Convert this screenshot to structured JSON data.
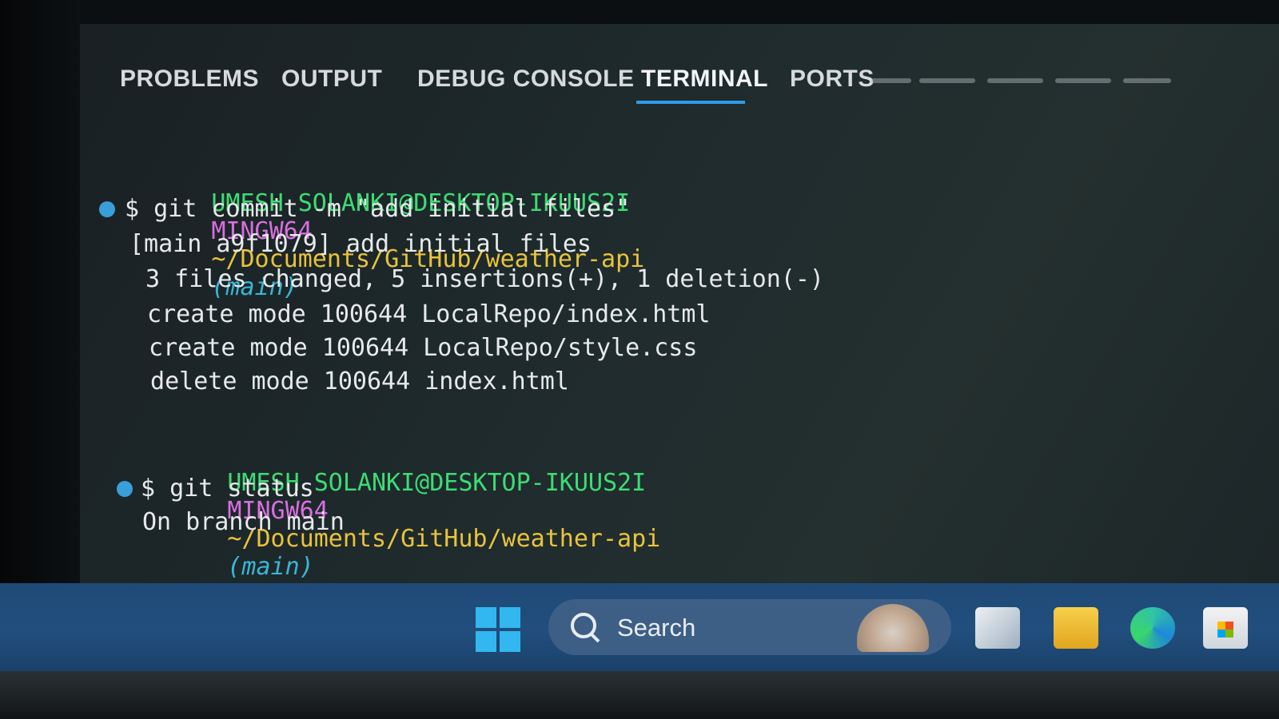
{
  "tabs": [
    {
      "label": "PROBLEMS"
    },
    {
      "label": "OUTPUT"
    },
    {
      "label": "DEBUG CONSOLE"
    },
    {
      "label": "TERMINAL",
      "active": true
    },
    {
      "label": "PORTS"
    }
  ],
  "colors": {
    "prompt_user": "#3ddc74",
    "prompt_host_env": "#d96fe0",
    "prompt_path": "#e9c33b",
    "prompt_branch": "#3ab5d6",
    "active_tab_underline": "#2f9be8",
    "taskbar": "#214e7d"
  },
  "terminal": {
    "block1": {
      "prompt": {
        "user": "UMESH SOLANKI@DESKTOP-IKUUS2I",
        "env": "MINGW64",
        "path": "~/Documents/GitHub/weather-api",
        "branch": "(main)"
      },
      "command": "$ git commit -m \"add initial files\"",
      "output": [
        "[main a9f1079] add initial files",
        " 3 files changed, 5 insertions(+), 1 deletion(-)",
        " create mode 100644 LocalRepo/index.html",
        " create mode 100644 LocalRepo/style.css",
        " delete mode 100644 index.html"
      ]
    },
    "block2": {
      "prompt": {
        "user": "UMESH SOLANKI@DESKTOP-IKUUS2I",
        "env": "MINGW64",
        "path": "~/Documents/GitHub/weather-api",
        "branch": "(main)"
      },
      "command": "$ git status",
      "output": [
        "On branch main"
      ]
    }
  },
  "taskbar": {
    "search_placeholder": "Search",
    "icons": [
      "windows-start-icon",
      "search-icon",
      "task-view-icon",
      "file-explorer-icon",
      "edge-browser-icon",
      "microsoft-store-icon"
    ]
  }
}
